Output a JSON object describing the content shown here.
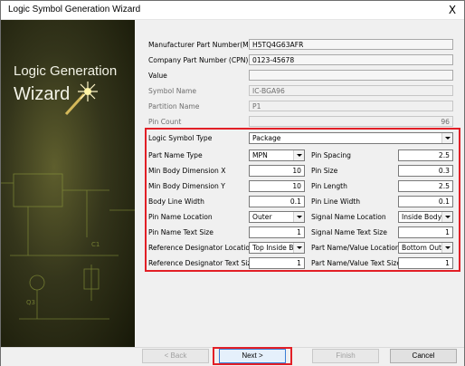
{
  "window": {
    "title": "Logic Symbol Generation Wizard",
    "close_glyph": "X"
  },
  "side": {
    "line1": "Logic Generation",
    "line2": "Wizard"
  },
  "info": [
    {
      "label": "Manufacturer Part Number(MPN)",
      "value": "H5TQ4G63AFR",
      "disabled": false
    },
    {
      "label": "Company Part Number (CPN)",
      "value": "0123-45678",
      "disabled": false
    },
    {
      "label": "Value",
      "value": "",
      "disabled": false
    },
    {
      "label": "Symbol Name",
      "value": "IC-BGA96",
      "disabled": true
    },
    {
      "label": "Partition Name",
      "value": "P1",
      "disabled": true
    },
    {
      "label": "Pin Count",
      "value": "96",
      "disabled": true
    }
  ],
  "symbol_type": {
    "label": "Logic Symbol Type",
    "value": "Package"
  },
  "left_params": [
    {
      "label": "Part Name Type",
      "value": "MPN",
      "kind": "select"
    },
    {
      "label": "Min Body Dimension X",
      "value": "10",
      "kind": "input"
    },
    {
      "label": "Min Body Dimension Y",
      "value": "10",
      "kind": "input"
    },
    {
      "label": "Body Line Width",
      "value": "0.1",
      "kind": "input"
    },
    {
      "label": "Pin Name Location",
      "value": "Outer",
      "kind": "select"
    },
    {
      "label": "Pin Name Text Size",
      "value": "1",
      "kind": "input"
    },
    {
      "label": "Reference Designator Location",
      "value": "Top Inside Bo",
      "kind": "select"
    },
    {
      "label": "Reference Designator Text Size",
      "value": "1",
      "kind": "input"
    }
  ],
  "right_params": [
    {
      "label": "Pin Spacing",
      "value": "2.5",
      "kind": "input"
    },
    {
      "label": "Pin Size",
      "value": "0.3",
      "kind": "input"
    },
    {
      "label": "Pin Length",
      "value": "2.5",
      "kind": "input"
    },
    {
      "label": "Pin Line Width",
      "value": "0.1",
      "kind": "input"
    },
    {
      "label": "Signal Name Location",
      "value": "Inside Body",
      "kind": "select"
    },
    {
      "label": "Signal Name Text Size",
      "value": "1",
      "kind": "input"
    },
    {
      "label": "Part Name/Value Location",
      "value": "Bottom Outsic",
      "kind": "select"
    },
    {
      "label": "Part Name/Value Text Size",
      "value": "1",
      "kind": "input"
    }
  ],
  "buttons": {
    "back": "< Back",
    "next": "Next >",
    "finish": "Finish",
    "cancel": "Cancel"
  },
  "colors": {
    "highlight": "#e21f26",
    "panel": "#f0f0f0",
    "side_dark": "#171808"
  }
}
